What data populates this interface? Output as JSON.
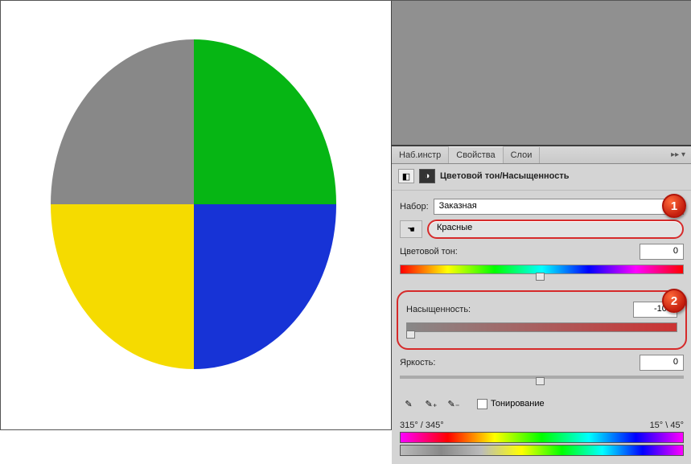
{
  "tabs": {
    "tools": "Наб.инстр",
    "properties": "Свойства",
    "layers": "Слои"
  },
  "panelTitle": "Цветовой тон/Насыщенность",
  "presetLabel": "Набор:",
  "presetValue": "Заказная",
  "colorRange": "Красные",
  "hueLabel": "Цветовой тон:",
  "hueValue": "0",
  "satLabel": "Насыщенность:",
  "satValue": "-100",
  "lightLabel": "Яркость:",
  "lightValue": "0",
  "colorizeLabel": "Тонирование",
  "rangeLeft": "315° / 345°",
  "rangeRight": "15° \\ 45°",
  "callouts": {
    "one": "1",
    "two": "2"
  },
  "circleColors": {
    "tl": "#888888",
    "tr": "#06b614",
    "bl": "#f5db00",
    "br": "#1733d6"
  }
}
